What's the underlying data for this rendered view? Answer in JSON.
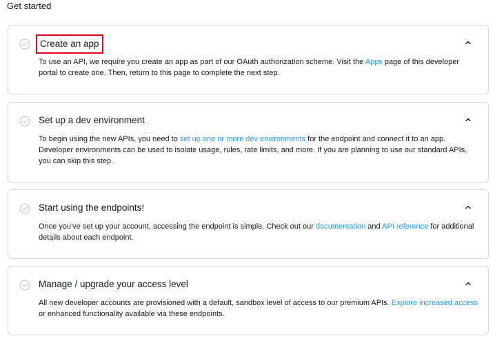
{
  "page": {
    "title": "Get started"
  },
  "colors": {
    "link": "#1d9bf0",
    "highlight_border": "#e0001b",
    "card_border": "#d4d9dd",
    "check_icon": "#c4cdd3"
  },
  "cards": [
    {
      "title": "Create an app",
      "body_before": "To use an API, we require you create an app as part of our OAuth authorization scheme. Visit the ",
      "link1": "Apps",
      "body_middle": " page of this developer portal to create one. Then, return to this page to complete the next step.",
      "expanded": true
    },
    {
      "title": "Set up a dev environment",
      "body_before": "To begin using the new APIs, you need to ",
      "link1": "set up one or more dev environments",
      "body_middle": " for the endpoint and connect it to an app. Developer environments can be used to isolate usage, rules, rate limits, and more. If you are planning to use our standard APIs, you can skip this step.",
      "expanded": true
    },
    {
      "title": "Start using the endpoints!",
      "body_before": "Once you've set up your account, accessing the endpoint is simple. Check out our ",
      "link1": "documentation",
      "body_middle": " and ",
      "link2": "API reference",
      "body_after": " for additional details about each endpoint.",
      "expanded": true
    },
    {
      "title": "Manage / upgrade your access level",
      "body_before": "All new developer accounts are provisioned with a default, sandbox level of access to our premium APIs. ",
      "link1": "Explore increased access",
      "body_middle": " or enhanced functionality available via these endpoints.",
      "expanded": true
    }
  ]
}
